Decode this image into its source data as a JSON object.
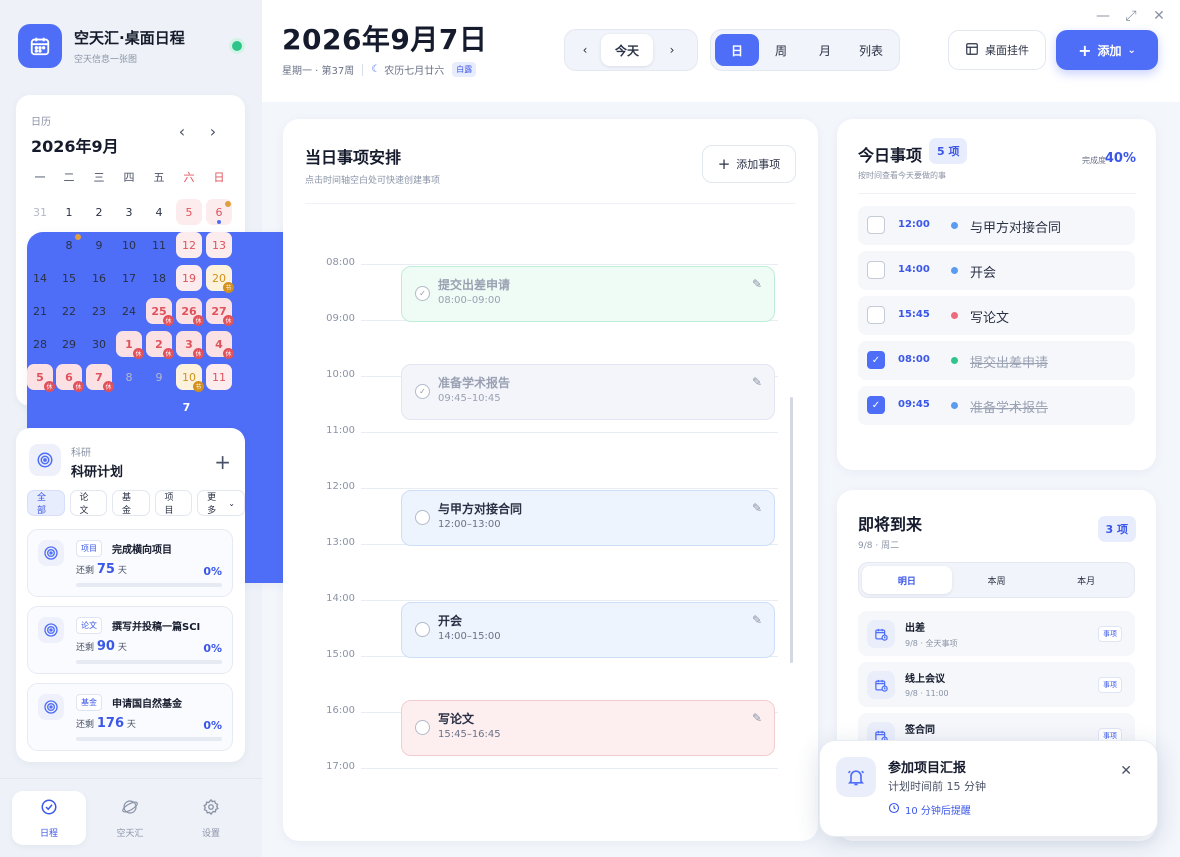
{
  "app": {
    "title": "空天汇·桌面日程",
    "subtitle": "空天信息一张图"
  },
  "sidebar": {
    "calendar": {
      "label": "日历",
      "month_title": "2026年9月",
      "weekdays": [
        "一",
        "二",
        "三",
        "四",
        "五",
        "六",
        "日"
      ],
      "weeks": [
        [
          "31",
          "1",
          "2",
          "3",
          "4",
          "5",
          "6"
        ],
        [
          "7",
          "8",
          "9",
          "10",
          "11",
          "12",
          "13"
        ],
        [
          "14",
          "15",
          "16",
          "17",
          "18",
          "19",
          "20"
        ],
        [
          "21",
          "22",
          "23",
          "24",
          "25",
          "26",
          "27"
        ],
        [
          "28",
          "29",
          "30",
          "1",
          "2",
          "3",
          "4"
        ],
        [
          "5",
          "6",
          "7",
          "8",
          "9",
          "10",
          "11"
        ]
      ],
      "holiday_badge": "休",
      "festival_badge": "节"
    },
    "plan": {
      "category": "科研",
      "title": "科研计划",
      "filters": [
        "全部",
        "论文",
        "基金",
        "项目",
        "更多"
      ],
      "items": [
        {
          "tag": "项目",
          "title": "完成横向项目",
          "left_prefix": "还剩",
          "days": "75",
          "unit": "天",
          "percent": "0%"
        },
        {
          "tag": "论文",
          "title": "撰写并投稿一篇SCI",
          "left_prefix": "还剩",
          "days": "90",
          "unit": "天",
          "percent": "0%"
        },
        {
          "tag": "基金",
          "title": "申请国自然基金",
          "left_prefix": "还剩",
          "days": "176",
          "unit": "天",
          "percent": "0%"
        }
      ]
    },
    "nav": [
      {
        "label": "日程"
      },
      {
        "label": "空天汇"
      },
      {
        "label": "设置"
      }
    ]
  },
  "header": {
    "date": "2026年9月7日",
    "weekday_week": "星期一 · 第37周",
    "lunar": "农历七月廿六",
    "solar_term": "白露",
    "today_label": "今天",
    "views": [
      "日",
      "周",
      "月",
      "列表"
    ],
    "widget_label": "桌面挂件",
    "add_label": "添加"
  },
  "schedule": {
    "title": "当日事项安排",
    "hint": "点击时间轴空白处可快速创建事项",
    "add_label": "添加事项",
    "hours": [
      "08:00",
      "09:00",
      "10:00",
      "11:00",
      "12:00",
      "13:00",
      "14:00",
      "15:00",
      "16:00",
      "17:00"
    ],
    "events": [
      {
        "title": "提交出差申请",
        "time": "08:00–09:00",
        "done": true
      },
      {
        "title": "准备学术报告",
        "time": "09:45–10:45",
        "done": true
      },
      {
        "title": "与甲方对接合同",
        "time": "12:00–13:00",
        "done": false
      },
      {
        "title": "开会",
        "time": "14:00–15:00",
        "done": false
      },
      {
        "title": "写论文",
        "time": "15:45–16:45",
        "done": false
      }
    ]
  },
  "today": {
    "title": "今日事项",
    "count": "5 项",
    "hint": "按时间查看今天要做的事",
    "progress_label": "完成度",
    "progress_value": "40%",
    "items": [
      {
        "time": "12:00",
        "title": "与甲方对接合同",
        "done": false,
        "color": "#5b9bf0"
      },
      {
        "time": "14:00",
        "title": "开会",
        "done": false,
        "color": "#5b9bf0"
      },
      {
        "time": "15:45",
        "title": "写论文",
        "done": false,
        "color": "#ef6b7a"
      },
      {
        "time": "08:00",
        "title": "提交出差申请",
        "done": true,
        "color": "#2fc58a"
      },
      {
        "time": "09:45",
        "title": "准备学术报告",
        "done": true,
        "color": "#5b9bf0"
      }
    ]
  },
  "upcoming": {
    "title": "即将到来",
    "date": "9/8 · 周二",
    "count": "3 项",
    "tabs": [
      "明日",
      "本周",
      "本月"
    ],
    "items": [
      {
        "title": "出差",
        "detail": "9/8 · 全天事项",
        "tag": "事项"
      },
      {
        "title": "线上会议",
        "detail": "9/8 · 11:00",
        "tag": "事项"
      },
      {
        "title": "签合同",
        "detail": "",
        "tag": "事项"
      }
    ]
  },
  "toast": {
    "title": "参加项目汇报",
    "subtitle": "计划时间前 15 分钟",
    "snooze": "10 分钟后提醒"
  },
  "colors": {
    "accent": "#4f6ef7",
    "weekend": "#e0525b",
    "festival": "#d2901e",
    "online": "#2fc58a"
  }
}
